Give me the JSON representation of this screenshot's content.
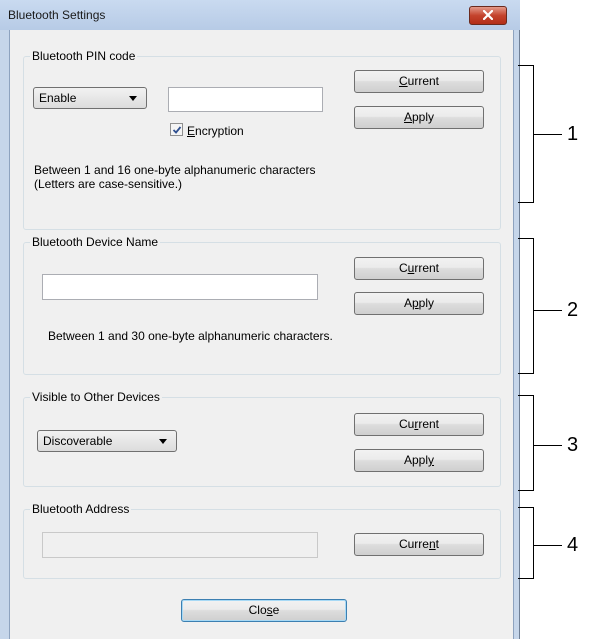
{
  "window": {
    "title": "Bluetooth Settings"
  },
  "pin_group": {
    "title": "Bluetooth PIN code",
    "mode_select": {
      "value": "Enable"
    },
    "pin_input": {
      "value": ""
    },
    "encryption": {
      "label_pre": "",
      "label_key": "E",
      "label_post": "ncryption",
      "checked": true
    },
    "current_button": {
      "pre": "",
      "key": "C",
      "post": "urrent"
    },
    "apply_button": {
      "pre": "",
      "key": "A",
      "post": "pply"
    },
    "hint_line1": "Between 1 and 16 one-byte alphanumeric characters",
    "hint_line2": "(Letters are case-sensitive.)"
  },
  "device_name_group": {
    "title": "Bluetooth Device Name",
    "name_input": {
      "value": ""
    },
    "current_button": {
      "pre": "C",
      "key": "u",
      "post": "rrent"
    },
    "apply_button": {
      "pre": "A",
      "key": "p",
      "post": "ply"
    },
    "hint": "Between 1 and 30 one-byte alphanumeric characters."
  },
  "visibility_group": {
    "title": "Visible to Other Devices",
    "visibility_select": {
      "value": "Discoverable"
    },
    "current_button": {
      "pre": "Cu",
      "key": "r",
      "post": "rent"
    },
    "apply_button": {
      "pre": "Appl",
      "key": "y",
      "post": ""
    }
  },
  "address_group": {
    "title": "Bluetooth Address",
    "address_input": {
      "value": ""
    },
    "current_button": {
      "pre": "Curre",
      "key": "n",
      "post": "t"
    }
  },
  "footer": {
    "close_button": {
      "pre": "Clo",
      "key": "s",
      "post": "e"
    }
  },
  "callouts": [
    "1",
    "2",
    "3",
    "4"
  ],
  "colors": {
    "titlebar": "#c9daf0",
    "client_bg": "#f0f0f0",
    "close_red": "#c4432d",
    "default_button_border": "#3c7fb1"
  }
}
